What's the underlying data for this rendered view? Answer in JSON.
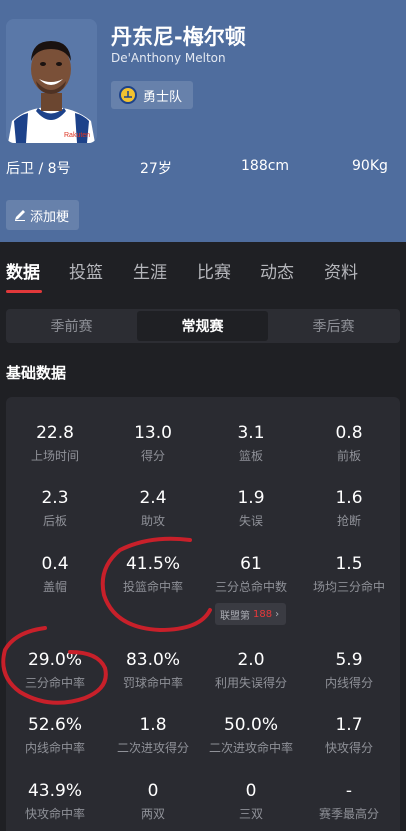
{
  "player": {
    "name_cn": "丹东尼-梅尔顿",
    "name_en": "De'Anthony Melton",
    "team": "勇士队",
    "position": "后卫 / 8号",
    "age": "27岁",
    "height": "188cm",
    "weight": "90Kg",
    "add_tag_label": "添加梗"
  },
  "tabs": [
    "数据",
    "投篮",
    "生涯",
    "比赛",
    "动态",
    "资料"
  ],
  "season_segments": [
    "季前赛",
    "常规赛",
    "季后赛"
  ],
  "section_title": "基础数据",
  "stats": [
    {
      "value": "22.8",
      "label": "上场时间"
    },
    {
      "value": "13.0",
      "label": "得分"
    },
    {
      "value": "3.1",
      "label": "篮板"
    },
    {
      "value": "0.8",
      "label": "前板"
    },
    {
      "value": "2.3",
      "label": "后板"
    },
    {
      "value": "2.4",
      "label": "助攻"
    },
    {
      "value": "1.9",
      "label": "失误"
    },
    {
      "value": "1.6",
      "label": "抢断"
    },
    {
      "value": "0.4",
      "label": "盖帽"
    },
    {
      "value": "41.5%",
      "label": "投篮命中率"
    },
    {
      "value": "61",
      "label": "三分总命中数"
    },
    {
      "value": "1.5",
      "label": "场均三分命中"
    },
    {
      "value": "29.0%",
      "label": "三分命中率"
    },
    {
      "value": "83.0%",
      "label": "罚球命中率"
    },
    {
      "value": "2.0",
      "label": "利用失误得分"
    },
    {
      "value": "5.9",
      "label": "内线得分"
    },
    {
      "value": "52.6%",
      "label": "内线命中率"
    },
    {
      "value": "1.8",
      "label": "二次进攻得分"
    },
    {
      "value": "50.0%",
      "label": "二次进攻命中率"
    },
    {
      "value": "1.7",
      "label": "快攻得分"
    },
    {
      "value": "43.9%",
      "label": "快攻命中率"
    },
    {
      "value": "0",
      "label": "两双"
    },
    {
      "value": "0",
      "label": "三双"
    },
    {
      "value": "-",
      "label": "赛季最高分"
    }
  ],
  "rank_badge": {
    "prefix": "联盟第",
    "number": "188",
    "arrow": "›"
  },
  "colors": {
    "header_bg": "#4f6d9e",
    "accent_red": "#e0383a",
    "card_bg": "#2a2b31",
    "page_bg": "#1f2024",
    "annotation": "#c8202a"
  },
  "icons": [
    "pen-icon",
    "warriors-logo-icon",
    "chevron-right-icon"
  ]
}
